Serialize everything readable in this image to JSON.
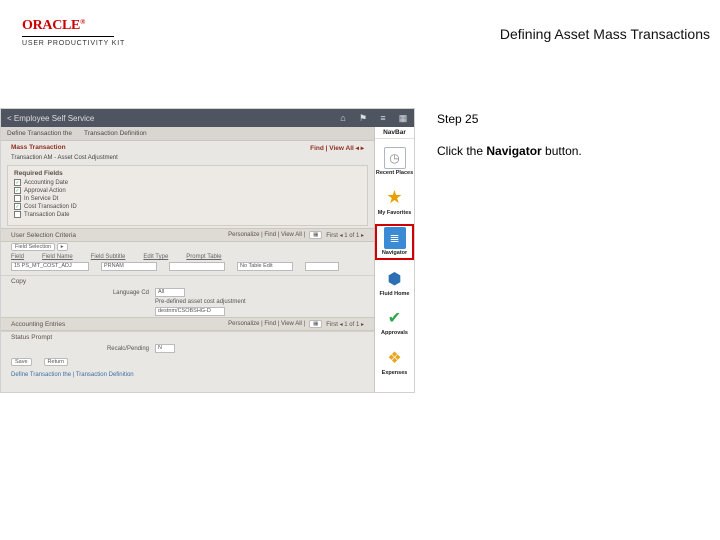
{
  "header": {
    "logo_text": "ORACLE",
    "logo_subtitle": "USER PRODUCTIVITY KIT",
    "page_title": "Defining Asset Mass Transactions"
  },
  "instructions": {
    "step_label": "Step 25",
    "line_a": "Click the ",
    "line_b_bold": "Navigator",
    "line_c": " button."
  },
  "screenshot": {
    "topbar": {
      "back_label": "< Employee Self Service"
    },
    "subbar": {
      "item1": "Define Transaction the",
      "item2": "Transaction Definition"
    },
    "mass_header": "Mass Transaction",
    "mass_right_a": "Find",
    "mass_right_b": "View All",
    "txn_label": "Transaction  AM - Asset Cost Adjustment",
    "required_title": "Required Fields",
    "checks": [
      "Accounting Date",
      "Approval Action",
      "In Service Dt",
      "Cost Transaction ID",
      "Transaction Date"
    ],
    "selection_title": "User Selection Criteria",
    "selection_right": "Personalize | Find | View All |",
    "personalize": "Personalize",
    "tabs_a": "Field Selection",
    "cols": {
      "field": "Field",
      "fieldname": "Field Name",
      "fieldsubtitle": "Field Subtitle",
      "edittype": "Edit Type",
      "prompttable": "Prompt Table"
    },
    "row": {
      "field": "15  PS_MT_COST_ADJ",
      "fieldname": "PRNAM",
      "edittype": "No Table Edit"
    },
    "copy": "Copy",
    "lang_k": "Language Cd",
    "lang_v": "All",
    "desc_k": "Pre-defined asset cost adjustment",
    "dest_k": "destnm/CSOBSHG-D",
    "acc_title": "Accounting Entries",
    "acc_right": "Personalize | Find | View All |",
    "status_title": "Status Prompt",
    "status_k": "Recalc/Pending",
    "status_v": "N",
    "save_col": "Save",
    "out_col": "Return",
    "footer": "Define Transaction the | Transaction Definition",
    "navbar": {
      "title": "NavBar",
      "items": [
        {
          "name": "recent-places",
          "label": "Recent Places"
        },
        {
          "name": "my-favorites",
          "label": "My Favorites"
        },
        {
          "name": "navigator",
          "label": "Navigator"
        },
        {
          "name": "fluid-home",
          "label": "Fluid Home"
        },
        {
          "name": "approvals",
          "label": "Approvals"
        },
        {
          "name": "expenses",
          "label": "Expenses"
        }
      ]
    }
  },
  "colors": {
    "oracle_red": "#c00",
    "highlight_red": "#d10000",
    "nav_star": "#e6a100",
    "nav_doc": "#3a8ad6",
    "nav_fluid": "#2c6fb3",
    "nav_approvals": "#2aa84a",
    "nav_expenses": "#e7a61e"
  }
}
